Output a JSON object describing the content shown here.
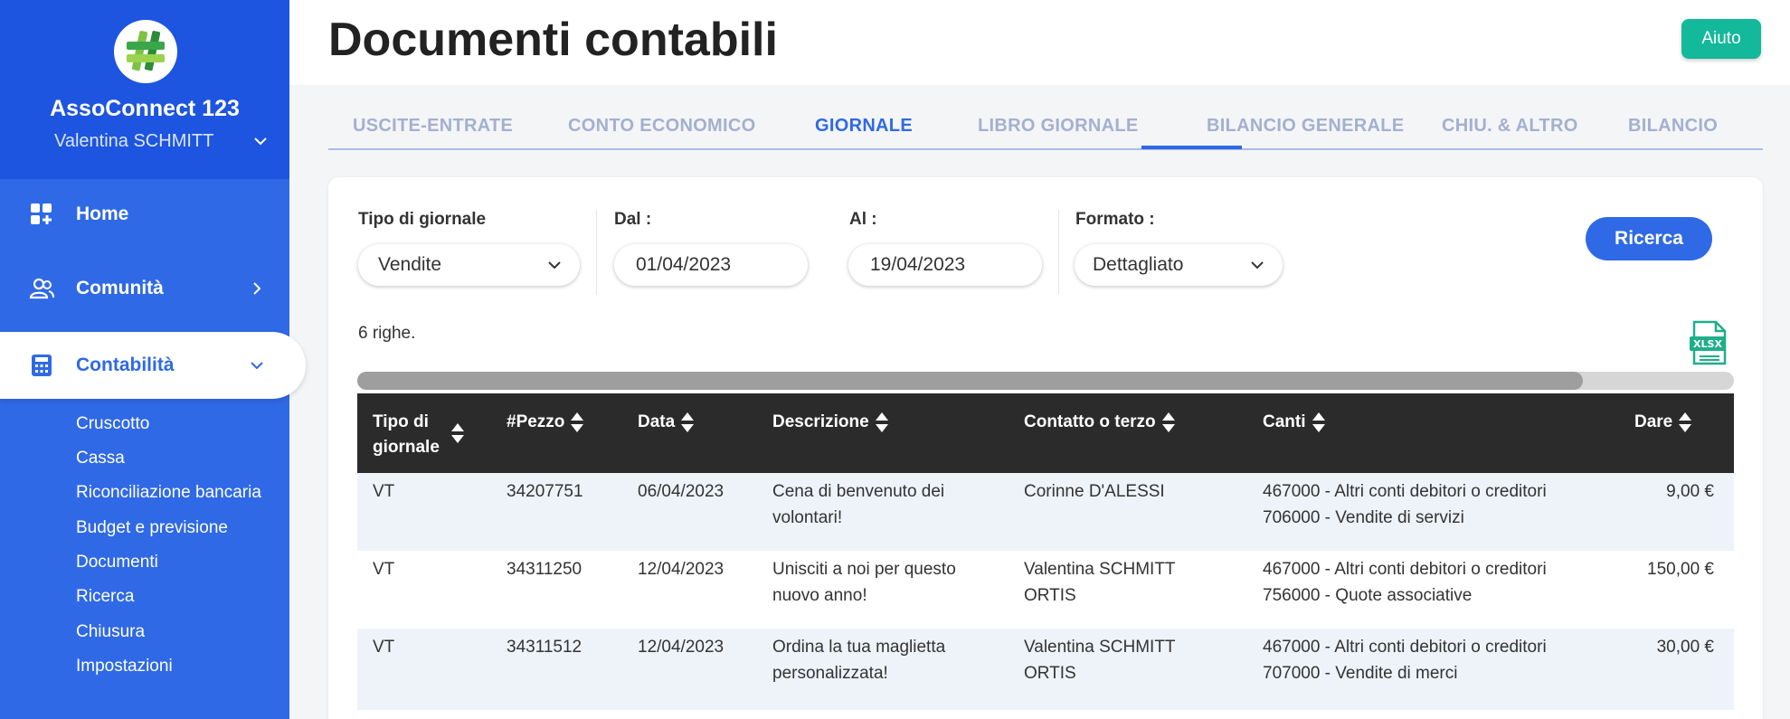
{
  "app": {
    "org_name": "AssoConnect 123",
    "user_name": "Valentina SCHMITT"
  },
  "nav": {
    "home": "Home",
    "community": "Comunità",
    "accounting": "Contabilità",
    "sub_items": [
      "Cruscotto",
      "Cassa",
      "Riconciliazione bancaria",
      "Budget e previsione",
      "Documenti",
      "Ricerca",
      "Chiusura",
      "Impostazioni"
    ]
  },
  "header": {
    "title": "Documenti contabili",
    "help_label": "Aiuto"
  },
  "tabs": [
    "USCITE-ENTRATE",
    "CONTO ECONOMICO",
    "GIORNALE",
    "LIBRO GIORNALE",
    "BILANCIO GENERALE",
    "CHIU. & ALTRO",
    "BILANCIO"
  ],
  "active_tab": "GIORNALE",
  "filters": {
    "journal_type_label": "Tipo di giornale",
    "journal_type_value": "Vendite",
    "from_label": "Dal :",
    "from_value": "01/04/2023",
    "to_label": "Al :",
    "to_value": "19/04/2023",
    "format_label": "Formato :",
    "format_value": "Dettagliato",
    "search_label": "Ricerca"
  },
  "results": {
    "count_text": "6 righe.",
    "export_label": "XLSX",
    "scroll_position_fraction": 0.89
  },
  "table": {
    "headers": [
      "Tipo di\ngiornale",
      "#Pezzo",
      "Data",
      "Descrizione",
      "Contatto o terzo",
      "Canti",
      "Dare"
    ],
    "rows": [
      {
        "type": "VT",
        "piece": "34207751",
        "date": "06/04/2023",
        "desc1": "Cena di benvenuto dei",
        "desc2": "volontari!",
        "contact1": "Corinne D'ALESSI",
        "contact2": "",
        "acc1": "467000 - Altri conti debitori o creditori",
        "acc2": "706000 - Vendite di servizi",
        "debit": "9,00 €"
      },
      {
        "type": "VT",
        "piece": "34311250",
        "date": "12/04/2023",
        "desc1": "Unisciti a noi per questo",
        "desc2": "nuovo anno!",
        "contact1": "Valentina SCHMITT",
        "contact2": "ORTIS",
        "acc1": "467000 - Altri conti debitori o creditori",
        "acc2": "756000 - Quote associative",
        "debit": "150,00 €"
      },
      {
        "type": "VT",
        "piece": "34311512",
        "date": "12/04/2023",
        "desc1": "Ordina la tua maglietta",
        "desc2": "personalizzata!",
        "contact1": "Valentina SCHMITT",
        "contact2": "ORTIS",
        "acc1": "467000 - Altri conti debitori o creditori",
        "acc2": "707000 - Vendite di merci",
        "debit": "30,00 €"
      }
    ]
  },
  "colors": {
    "primary": "#2f69e6",
    "sidebar_top": "#1d55e0",
    "help_button": "#14b89a",
    "table_header": "#2b2b2b",
    "row_alt": "#eef3f9"
  },
  "icons": {
    "logo": "hashtag-logo",
    "home": "dashboard-icon",
    "community": "users-icon",
    "accounting": "calculator-icon",
    "export": "xlsx-file-icon"
  }
}
